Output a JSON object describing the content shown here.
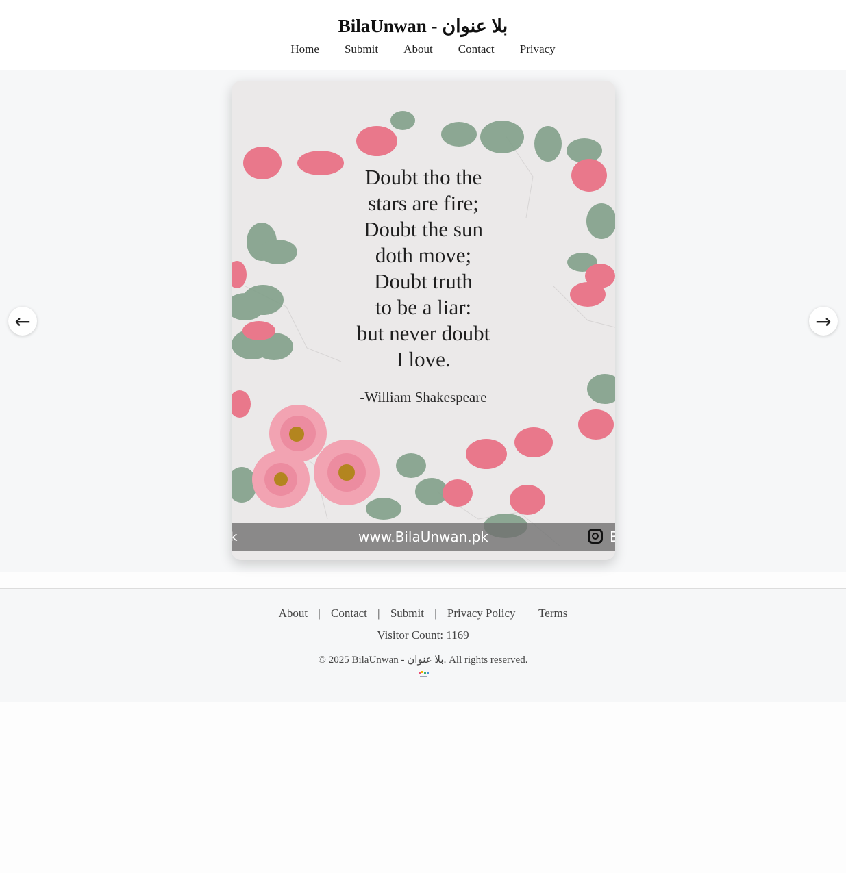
{
  "site": {
    "title": "BilaUnwan - بلا عنوان"
  },
  "nav": {
    "items": [
      "Home",
      "Submit",
      "About",
      "Contact",
      "Privacy"
    ]
  },
  "slide": {
    "quote": "Doubt tho the\nstars are fire;\nDoubt the sun\ndoth move;\nDoubt truth\nto be a liar:\nbut never doubt\nI love.",
    "author": "-William Shakespeare",
    "banner_url": "www.BilaUnwan.pk",
    "banner_left_fragment": "k",
    "banner_right_fragment": "B"
  },
  "controls": {
    "prev_icon": "←",
    "next_icon": "→"
  },
  "footer": {
    "links": [
      "About",
      "Contact",
      "Submit",
      "Privacy Policy",
      "Terms"
    ],
    "separator": "|",
    "visitor_count": "Visitor Count: 1169",
    "copyright": "© 2025 BilaUnwan - بلا عنوان. All rights reserved."
  },
  "colors": {
    "page_bg": "#fdfdfd",
    "header_bg": "#ffffff",
    "slider_bg": "#f6f7f8",
    "footer_bg": "#f6f7f8",
    "petal_pink": "#e97a8c",
    "leaf_green": "#7f9e88"
  }
}
